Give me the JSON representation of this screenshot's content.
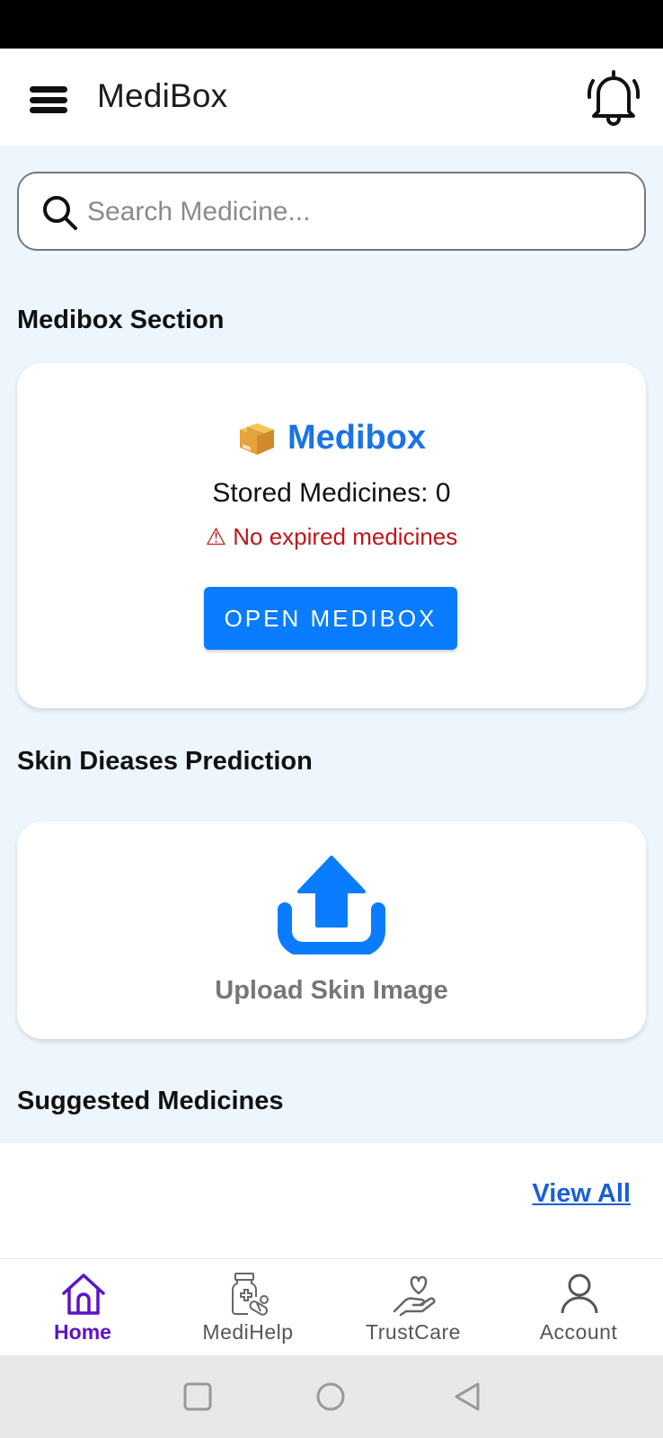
{
  "app": {
    "title": "MediBox"
  },
  "search": {
    "placeholder": "Search Medicine...",
    "value": ""
  },
  "sections": {
    "medibox": "Medibox Section",
    "skin": "Skin Dieases Prediction",
    "suggested": "Suggested Medicines"
  },
  "medibox_card": {
    "emoji": "📦",
    "title": "Medibox",
    "stored": "Stored Medicines: 0",
    "expired": "⚠ No expired medicines",
    "button": "OPEN MEDIBOX"
  },
  "upload_card": {
    "label": "Upload Skin Image"
  },
  "suggested": {
    "view_all": "View All"
  },
  "bottom_nav": [
    {
      "label": "Home",
      "icon": "home-icon",
      "active": true
    },
    {
      "label": "MediHelp",
      "icon": "medicine-bottle-icon",
      "active": false
    },
    {
      "label": "TrustCare",
      "icon": "heart-hand-icon",
      "active": false
    },
    {
      "label": "Account",
      "icon": "account-icon",
      "active": false
    }
  ],
  "colors": {
    "accent": "#0A7CFF",
    "title_blue": "#1A73E8",
    "warning_red": "#C0151B",
    "nav_active": "#5B13C9",
    "background": "#EDF5FD"
  }
}
